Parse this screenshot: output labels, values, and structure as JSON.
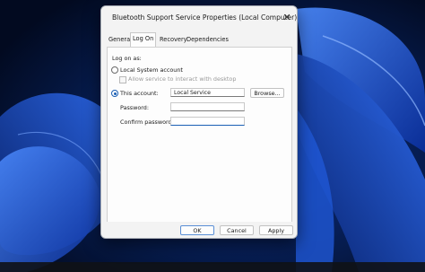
{
  "dialog": {
    "title": "Bluetooth Support Service Properties (Local Computer)",
    "close_glyph": "✕"
  },
  "tabs": [
    {
      "label": "General",
      "active": false
    },
    {
      "label": "Log On",
      "active": true
    },
    {
      "label": "Recovery",
      "active": false
    },
    {
      "label": "Dependencies",
      "active": false
    }
  ],
  "logon": {
    "section_label": "Log on as:",
    "local_system_label": "Local System account",
    "local_system_selected": false,
    "allow_interact_label": "Allow service to interact with desktop",
    "allow_interact_checked": false,
    "this_account_label": "This account:",
    "this_account_selected": true,
    "account_value": "Local Service",
    "browse_label": "Browse...",
    "password_label": "Password:",
    "password_value": "",
    "confirm_password_label": "Confirm password:",
    "confirm_password_value": ""
  },
  "footer": {
    "ok_label": "OK",
    "cancel_label": "Cancel",
    "apply_label": "Apply"
  },
  "colors": {
    "accent": "#1a5fb4",
    "wallpaper": "#0a3cb4"
  }
}
